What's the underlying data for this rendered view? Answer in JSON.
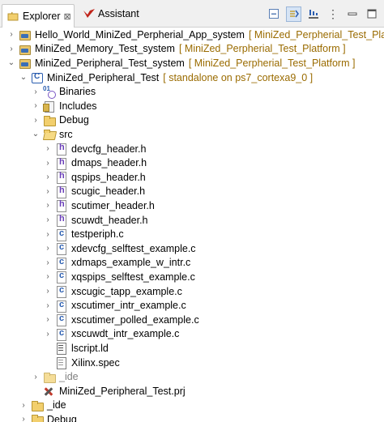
{
  "tabs": [
    {
      "label": "Explorer",
      "icon": "folder-icon",
      "active": true,
      "close": "⊠"
    },
    {
      "label": "Assistant",
      "icon": "vitis-logo-icon",
      "active": false
    }
  ],
  "toolbar": [
    {
      "name": "collapse-all-button",
      "icon": "collapse-all-icon"
    },
    {
      "name": "link-with-editor-button",
      "icon": "link-with-editor-icon",
      "pressed": true
    },
    {
      "name": "filters-button",
      "icon": "filters-icon"
    },
    {
      "name": "view-menu-button",
      "icon": "view-menu-icon",
      "glyph": "⋮"
    },
    {
      "name": "minimize-button",
      "icon": "minimize-icon"
    },
    {
      "name": "maximize-button",
      "icon": "maximize-icon"
    }
  ],
  "tree": [
    {
      "label": "Hello_World_MiniZed_Perpherial_App_system",
      "decoration": "[ MiniZed_Perpherial_Test_Platfo",
      "icon": "system-project-icon",
      "state": "collapsed"
    },
    {
      "label": "MiniZed_Memory_Test_system",
      "decoration": "[ MiniZed_Perpherial_Test_Platform ]",
      "icon": "system-project-icon",
      "state": "collapsed"
    },
    {
      "label": "MiniZed_Peripheral_Test_system",
      "decoration": "[ MiniZed_Perpherial_Test_Platform ]",
      "icon": "system-project-icon",
      "state": "expanded"
    },
    {
      "label": "MiniZed_Peripheral_Test",
      "decoration": "[ standalone on ps7_cortexa9_0 ]",
      "icon": "application-project-icon",
      "state": "expanded"
    },
    {
      "label": "Binaries",
      "icon": "binaries-icon",
      "state": "collapsed"
    },
    {
      "label": "Includes",
      "icon": "includes-icon",
      "state": "collapsed"
    },
    {
      "label": "Debug",
      "icon": "folder-icon",
      "state": "collapsed"
    },
    {
      "label": "src",
      "icon": "folder-open-icon",
      "state": "expanded"
    },
    {
      "label": "devcfg_header.h",
      "icon": "h-file-icon",
      "state": "collapsed"
    },
    {
      "label": "dmaps_header.h",
      "icon": "h-file-icon",
      "state": "collapsed"
    },
    {
      "label": "qspips_header.h",
      "icon": "h-file-icon",
      "state": "collapsed"
    },
    {
      "label": "scugic_header.h",
      "icon": "h-file-icon",
      "state": "collapsed"
    },
    {
      "label": "scutimer_header.h",
      "icon": "h-file-icon",
      "state": "collapsed"
    },
    {
      "label": "scuwdt_header.h",
      "icon": "h-file-icon",
      "state": "collapsed"
    },
    {
      "label": "testperiph.c",
      "icon": "c-file-icon",
      "state": "collapsed"
    },
    {
      "label": "xdevcfg_selftest_example.c",
      "icon": "c-file-icon",
      "state": "collapsed"
    },
    {
      "label": "xdmaps_example_w_intr.c",
      "icon": "c-file-icon",
      "state": "collapsed"
    },
    {
      "label": "xqspips_selftest_example.c",
      "icon": "c-file-icon",
      "state": "collapsed"
    },
    {
      "label": "xscugic_tapp_example.c",
      "icon": "c-file-icon",
      "state": "collapsed"
    },
    {
      "label": "xscutimer_intr_example.c",
      "icon": "c-file-icon",
      "state": "collapsed"
    },
    {
      "label": "xscutimer_polled_example.c",
      "icon": "c-file-icon",
      "state": "collapsed"
    },
    {
      "label": "xscuwdt_intr_example.c",
      "icon": "c-file-icon",
      "state": "collapsed"
    },
    {
      "label": "lscript.ld",
      "icon": "linker-script-icon",
      "state": "leaf"
    },
    {
      "label": "Xilinx.spec",
      "icon": "spec-file-icon",
      "state": "leaf"
    },
    {
      "label": "_ide",
      "icon": "folder-icon",
      "state": "collapsed",
      "muted": true
    },
    {
      "label": "MiniZed_Peripheral_Test.prj",
      "icon": "prj-file-icon",
      "state": "leaf"
    },
    {
      "label": "_ide",
      "icon": "folder-icon",
      "state": "collapsed"
    },
    {
      "label": "Debug",
      "icon": "folder-icon",
      "state": "collapsed"
    }
  ],
  "chevrons": {
    "collapsed": "›",
    "expanded": "⌄"
  },
  "colors": {
    "decoration": "#9a6b00",
    "muted": "#808080",
    "tab_background": "#f0f0f0"
  }
}
